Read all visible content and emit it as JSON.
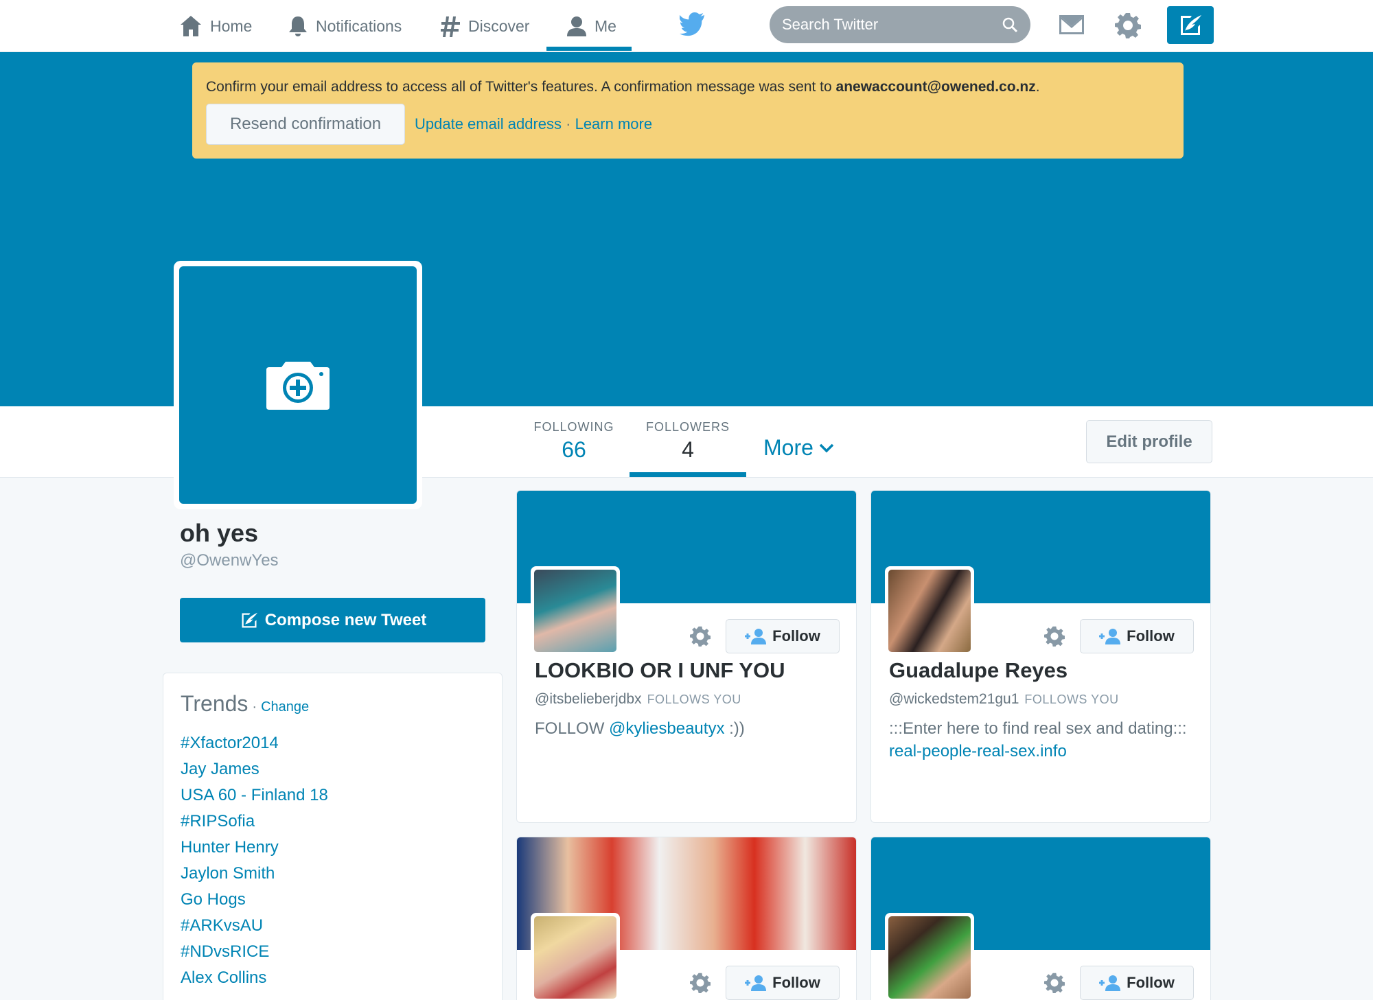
{
  "nav": {
    "home": "Home",
    "notifications": "Notifications",
    "discover": "Discover",
    "me": "Me",
    "search_placeholder": "Search Twitter"
  },
  "alert": {
    "text": "Confirm your email address to access all of Twitter's features. A confirmation message was sent to ",
    "email": "anewaccount@owened.co.nz",
    "period": ".",
    "resend": "Resend confirmation",
    "update": "Update email address",
    "sep": " · ",
    "learn": "Learn more"
  },
  "profile": {
    "name": "oh yes",
    "handle": "@OwenwYes",
    "compose": "Compose new Tweet",
    "following_label": "FOLLOWING",
    "following_count": "66",
    "followers_label": "FOLLOWERS",
    "followers_count": "4",
    "more": "More",
    "edit": "Edit profile"
  },
  "trends": {
    "title": "Trends",
    "dot": "·",
    "change": "Change",
    "items": [
      "#Xfactor2014",
      "Jay James",
      "USA 60 - Finland 18",
      "#RIPSofia",
      "Hunter Henry",
      "Jaylon Smith",
      "Go Hogs",
      "#ARKvsAU",
      "#NDvsRICE",
      "Alex Collins"
    ]
  },
  "cards": [
    {
      "name": "LOOKBIO OR I UNF YOU",
      "handle": "@itsbelieberjdbx",
      "follows_you": "FOLLOWS YOU",
      "bio_text": "FOLLOW ",
      "bio_link": "@kyliesbeautyx",
      "bio_after": " :))",
      "follow": "Follow"
    },
    {
      "name": "Guadalupe Reyes",
      "handle": "@wickedstem21gu1",
      "follows_you": "FOLLOWS YOU",
      "bio_text": ":::Enter here to find real sex and dating::: ",
      "bio_link": "real-people-real-sex.info",
      "bio_after": "",
      "follow": "Follow"
    },
    {
      "follow": "Follow"
    },
    {
      "follow": "Follow"
    }
  ],
  "colors": {
    "brand": "#0084b4",
    "alert_bg": "#f5d27a",
    "background": "#f5f8fa"
  }
}
